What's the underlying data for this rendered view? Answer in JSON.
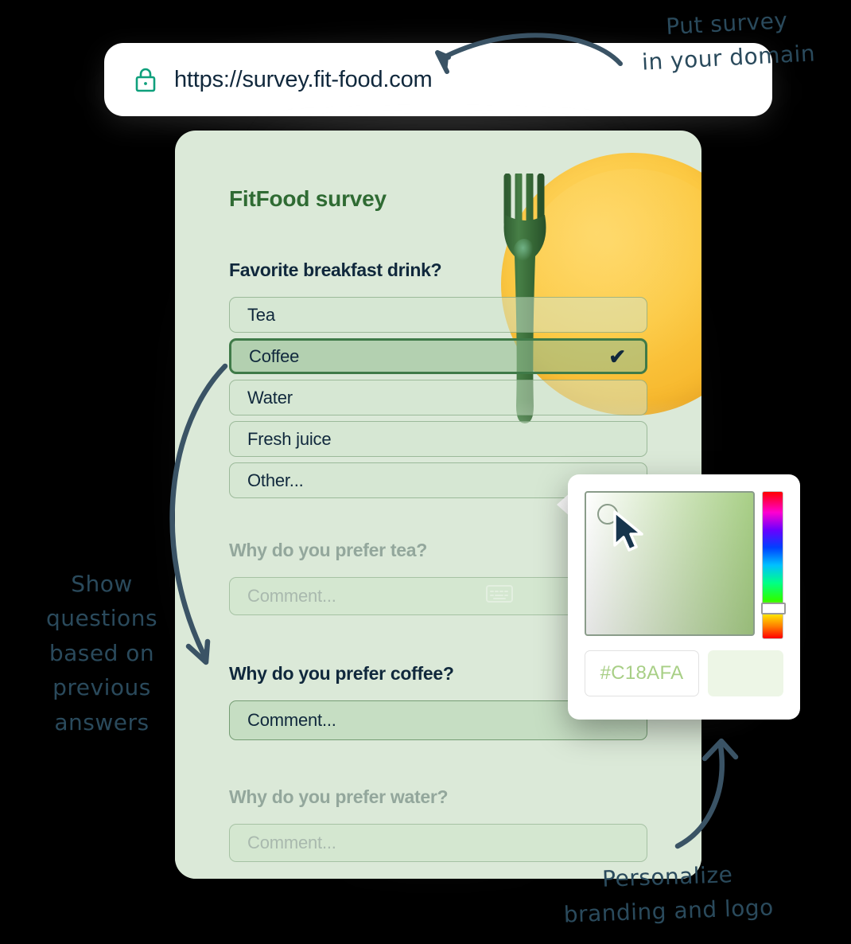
{
  "browser": {
    "lock_icon": "padlock-icon",
    "url": "https://survey.fit-food.com"
  },
  "survey": {
    "brand_title": "FitFood survey",
    "questions": [
      {
        "id": "drink",
        "label": "Favorite breakfast drink?",
        "state": "active",
        "options": [
          {
            "label": "Tea",
            "selected": false
          },
          {
            "label": "Coffee",
            "selected": true
          },
          {
            "label": "Water",
            "selected": false
          },
          {
            "label": "Fresh juice",
            "selected": false
          },
          {
            "label": "Other...",
            "selected": false
          }
        ]
      },
      {
        "id": "why-tea",
        "label": "Why do you prefer tea?",
        "state": "dimmed",
        "comment_placeholder": "Comment...",
        "keyboard_icon": "keyboard-icon"
      },
      {
        "id": "why-coffee",
        "label": "Why do you prefer coffee?",
        "state": "active",
        "comment_placeholder": "Comment..."
      },
      {
        "id": "why-water",
        "label": "Why do you prefer water?",
        "state": "dimmed",
        "comment_placeholder": "Comment..."
      }
    ],
    "check_glyph": "✔"
  },
  "color_picker": {
    "hex_value": "#C18AFA",
    "swatch_color": "#EDF6E6",
    "saturation_area": "saturation-gradient",
    "hue_slider": "hue-slider",
    "cursor": "mouse-cursor"
  },
  "annotations": {
    "domain": "Put survey\nin your domain",
    "domain_line1": "Put survey",
    "domain_line2": "in your domain",
    "conditional": "Show\nquestions\nbased on\nprevious\nanswers",
    "conditional_line1": "Show",
    "conditional_line2": "questions",
    "conditional_line3": "based on",
    "conditional_line4": "previous",
    "conditional_line5": "answers",
    "branding_line1": "Personalize",
    "branding_line2": "branding and logo"
  },
  "colors": {
    "ink": "#2a4a5c",
    "brand_green": "#2F6B33",
    "navy": "#10283C",
    "card_bg": "#DBE9D8",
    "lock_teal": "#0FA07C",
    "plate_yellow": "#FCC943",
    "fork_green": "#3C6B3C",
    "hex_text": "#A8CF86"
  }
}
